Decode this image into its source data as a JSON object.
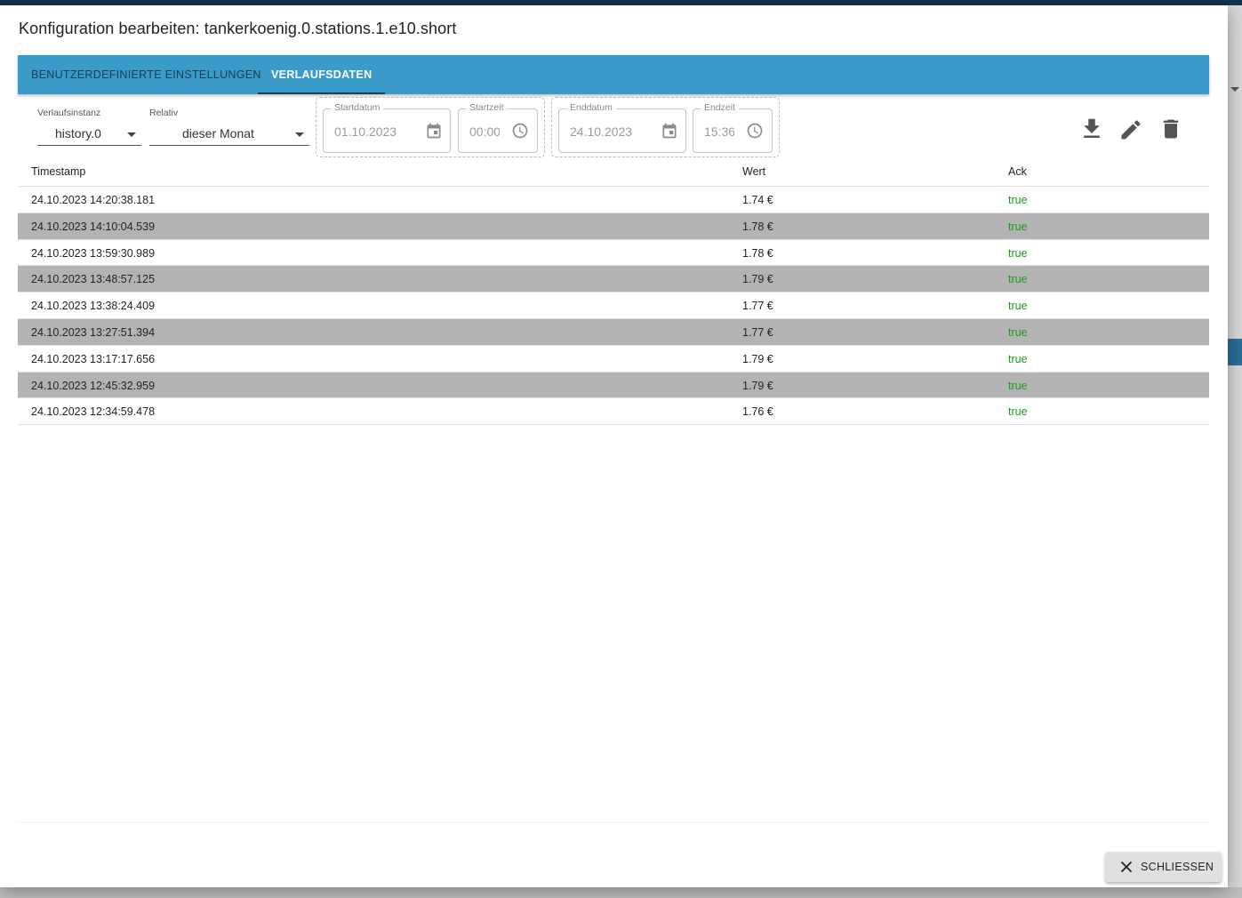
{
  "dialog": {
    "title": "Konfiguration bearbeiten: tankerkoenig.0.stations.1.e10.short",
    "close_label": "SCHLIESSEN"
  },
  "tabs": [
    {
      "label": "BENUTZERDEFINIERTE EINSTELLUNGEN",
      "active": false
    },
    {
      "label": "VERLAUFSDATEN",
      "active": true
    }
  ],
  "filters": {
    "instance": {
      "label": "Verlaufsinstanz",
      "value": "history.0"
    },
    "relative": {
      "label": "Relativ",
      "value": "dieser Monat"
    },
    "start_date": {
      "label": "Startdatum",
      "value": "01.10.2023"
    },
    "start_time": {
      "label": "Startzeit",
      "value": "00:00"
    },
    "end_date": {
      "label": "Enddatum",
      "value": "24.10.2023"
    },
    "end_time": {
      "label": "Endzeit",
      "value": "15:36"
    }
  },
  "toolbar_icons": [
    "download-icon",
    "edit-icon",
    "delete-icon"
  ],
  "table": {
    "columns": [
      "Timestamp",
      "Wert",
      "Ack"
    ],
    "rows": [
      {
        "timestamp": "24.10.2023 14:20:38.181",
        "value": "1.74 €",
        "ack": "true"
      },
      {
        "timestamp": "24.10.2023 14:10:04.539",
        "value": "1.78 €",
        "ack": "true"
      },
      {
        "timestamp": "24.10.2023 13:59:30.989",
        "value": "1.78 €",
        "ack": "true"
      },
      {
        "timestamp": "24.10.2023 13:48:57.125",
        "value": "1.79 €",
        "ack": "true"
      },
      {
        "timestamp": "24.10.2023 13:38:24.409",
        "value": "1.77 €",
        "ack": "true"
      },
      {
        "timestamp": "24.10.2023 13:27:51.394",
        "value": "1.77 €",
        "ack": "true"
      },
      {
        "timestamp": "24.10.2023 13:17:17.656",
        "value": "1.79 €",
        "ack": "true"
      },
      {
        "timestamp": "24.10.2023 12:45:32.959",
        "value": "1.79 €",
        "ack": "true"
      },
      {
        "timestamp": "24.10.2023 12:34:59.478",
        "value": "1.76 €",
        "ack": "true"
      }
    ]
  },
  "colors": {
    "tab_bar": "#3a9bcb",
    "alt_row": "#b3b3b3",
    "ack_true": "#1a9a1a"
  }
}
